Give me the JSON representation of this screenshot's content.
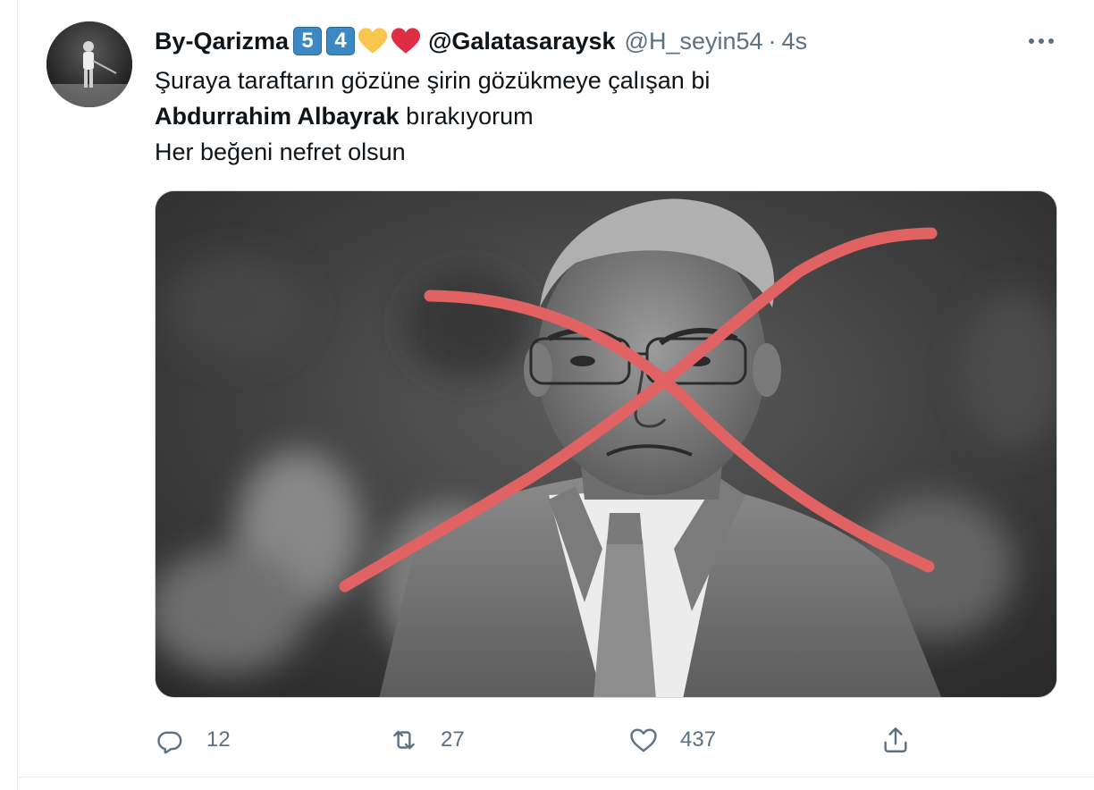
{
  "tweet": {
    "display_name": "By-Qarizma",
    "badges": [
      "5",
      "4"
    ],
    "heart_colors": [
      "#f7c74d",
      "#dd2e44"
    ],
    "name_suffix": "@Galatasaraysk",
    "handle": "@H_seyin54",
    "separator": "·",
    "time": "4s",
    "text": {
      "line1": "Şuraya taraftarın gözüne şirin gözükmeye çalışan bi",
      "line2_bold": "Abdurrahim Albayrak",
      "line2_rest": " bırakıyorum",
      "line3": "Her beğeni nefret olsun"
    },
    "actions": {
      "reply_count": "12",
      "retweet_count": "27",
      "like_count": "437"
    }
  },
  "icons": {
    "more": "more-horizontal-icon",
    "reply": "reply-icon",
    "retweet": "retweet-icon",
    "like": "heart-icon",
    "share": "share-icon"
  },
  "colors": {
    "text_primary": "#0f1419",
    "text_secondary": "#5b7083",
    "cross_mark": "#e06262"
  }
}
